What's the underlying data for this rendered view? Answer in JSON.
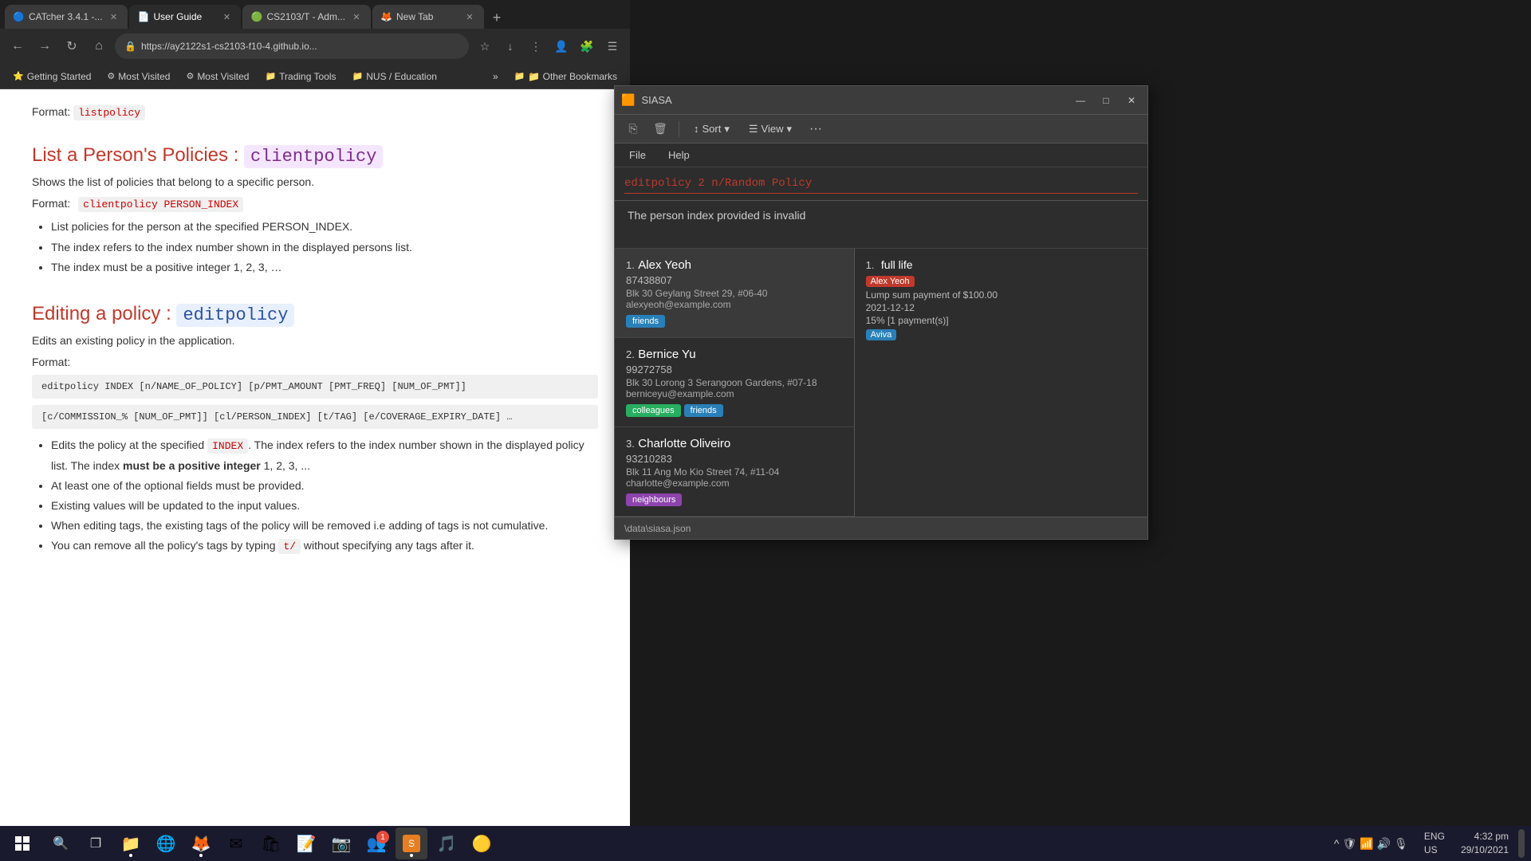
{
  "browser": {
    "tabs": [
      {
        "id": "tab1",
        "favicon": "🔵",
        "title": "CATcher 3.4.1 -...",
        "active": false
      },
      {
        "id": "tab2",
        "favicon": "📄",
        "title": "User Guide",
        "active": true
      },
      {
        "id": "tab3",
        "favicon": "🟢",
        "title": "CS2103/T - Adm...",
        "active": false
      },
      {
        "id": "tab4",
        "favicon": "🦊",
        "title": "New Tab",
        "active": false
      }
    ],
    "address": "https://ay2122s1-cs2103-f10-4.github.io...",
    "bookmarks": [
      {
        "icon": "⭐",
        "label": "Getting Started"
      },
      {
        "icon": "⚙",
        "label": "Most Visited"
      },
      {
        "icon": "⚙",
        "label": "Most Visited"
      },
      {
        "icon": "📁",
        "label": "Trading Tools"
      },
      {
        "icon": "📁",
        "label": "NUS / Education"
      }
    ],
    "overflow_label": "»",
    "other_bookmarks": "📁 Other Bookmarks"
  },
  "page": {
    "format_label": "Format:",
    "format_code1": "listpolicy",
    "section1": {
      "heading_text": "List a Person's Policies : ",
      "heading_code": "clientpolicy",
      "desc": "Shows the list of policies that belong to a specific person.",
      "format_label": "Format:",
      "format_code": "clientpolicy PERSON_INDEX",
      "bullets": [
        "List policies for the person at the specified PERSON_INDEX.",
        "The index refers to the index number shown in the displayed persons list.",
        "The index must be a positive integer 1, 2, 3, …"
      ]
    },
    "section2": {
      "heading_text": "Editing a policy : ",
      "heading_code": "editpolicy",
      "desc": "Edits an existing policy in the application.",
      "format_label": "Format:",
      "format_code1": "editpolicy INDEX [n/NAME_OF_POLICY] [p/PMT_AMOUNT [PMT_FREQ] [NUM_OF_PMT]]",
      "format_code2": "[c/COMMISSION_% [NUM_OF_PMT]] [cl/PERSON_INDEX] [t/TAG] [e/COVERAGE_EXPIRY_DATE] …",
      "bullets": [
        {
          "text": "Edits the policy at the specified ",
          "code": "INDEX",
          "rest": ". The index refers to the index number shown in the displayed policy list. The index ",
          "bold": "must be a positive integer",
          "end": " 1, 2, 3, ..."
        },
        {
          "text": "At least one of the optional fields must be provided.",
          "code": null
        },
        {
          "text": "Existing values will be updated to the input values.",
          "code": null
        },
        {
          "text": "When editing tags, the existing tags of the policy will be removed i.e adding of tags is not cumulative.",
          "code": null
        },
        {
          "text": "You can remove all the policy's tags by typing ",
          "code": "t/",
          "rest": " without specifying any tags after it.",
          "code2": null
        }
      ]
    }
  },
  "siasa": {
    "title": "SIASA",
    "menu_items": [
      "File",
      "Help"
    ],
    "toolbar": {
      "sort_label": "Sort",
      "view_label": "View",
      "more_label": "···"
    },
    "command_input": "editpolicy 2 n/Random Policy",
    "error_message": "The person index provided is invalid",
    "persons": [
      {
        "number": "1.",
        "name": "Alex Yeoh",
        "phone": "87438807",
        "address": "Blk 30 Geylang Street 29, #06-40",
        "email": "alexyeoh@example.com",
        "tags": [
          {
            "label": "friends",
            "type": "friends"
          }
        ]
      },
      {
        "number": "2.",
        "name": "Bernice Yu",
        "phone": "99272758",
        "address": "Blk 30 Lorong 3 Serangoon Gardens, #07-18",
        "email": "berniceyu@example.com",
        "tags": [
          {
            "label": "colleagues",
            "type": "colleagues"
          },
          {
            "label": "friends",
            "type": "friends"
          }
        ]
      },
      {
        "number": "3.",
        "name": "Charlotte Oliveiro",
        "phone": "93210283",
        "address": "Blk 11 Ang Mo Kio Street 74, #11-04",
        "email": "charlotte@example.com",
        "tags": [
          {
            "label": "neighbours",
            "type": "neighbours"
          }
        ]
      }
    ],
    "policies": [
      {
        "number": "1.",
        "name": "full life",
        "owner_tag": "Alex Yeoh",
        "details": [
          "Lump sum payment of $100.00",
          "2021-12-12",
          "15% [1 payment(s)]"
        ],
        "company_tag": "Aviva"
      }
    ],
    "footer_text": "\\data\\siasa.json"
  },
  "taskbar": {
    "time": "4:32 pm",
    "date": "29/10/2021",
    "lang": "ENG",
    "region": "US",
    "icons": [
      {
        "name": "windows-start",
        "symbol": "⊞"
      },
      {
        "name": "search",
        "symbol": "🔍"
      },
      {
        "name": "task-view",
        "symbol": "❐"
      },
      {
        "name": "file-explorer",
        "symbol": "📁"
      },
      {
        "name": "edge",
        "symbol": "🌐"
      },
      {
        "name": "firefox",
        "symbol": "🦊"
      },
      {
        "name": "mail",
        "symbol": "✉"
      },
      {
        "name": "windows-store",
        "symbol": "🛍"
      },
      {
        "name": "notepad",
        "symbol": "📝"
      },
      {
        "name": "camera",
        "symbol": "📷"
      },
      {
        "name": "teams",
        "symbol": "👥"
      },
      {
        "name": "spotify",
        "symbol": "🎵"
      },
      {
        "name": "app1",
        "symbol": "🟡"
      }
    ]
  }
}
